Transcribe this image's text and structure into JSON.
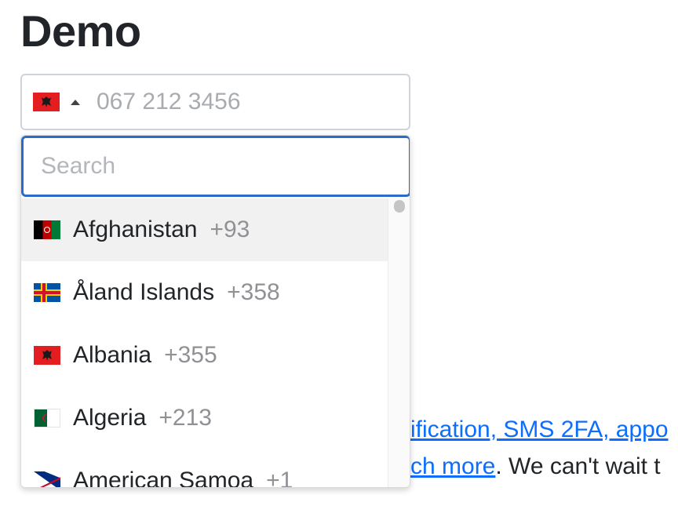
{
  "page": {
    "title": "Demo",
    "body_line1_link": "ification, SMS 2FA, appo",
    "body_line2_link": "ch more",
    "body_line2_text": ". We can't wait t"
  },
  "phone_input": {
    "selected_country": "Albania",
    "selected_flag": "albania-flag-icon",
    "caret_icon": "caret-up-icon",
    "placeholder": "067 212 3456",
    "value": ""
  },
  "dropdown": {
    "search_placeholder": "Search",
    "search_value": "",
    "countries": [
      {
        "name": "Afghanistan",
        "code": "+93",
        "flag": "afghanistan-flag-icon"
      },
      {
        "name": "Åland Islands",
        "code": "+358",
        "flag": "aland-flag-icon"
      },
      {
        "name": "Albania",
        "code": "+355",
        "flag": "albania-flag-icon"
      },
      {
        "name": "Algeria",
        "code": "+213",
        "flag": "algeria-flag-icon"
      },
      {
        "name": "American Samoa",
        "code": "+1",
        "flag": "american-samoa-flag-icon"
      }
    ]
  },
  "colors": {
    "link": "#0d6efd",
    "focus_border": "#2a6cc8",
    "highlight_row": "#f1f1f1",
    "dial_code": "#8f9194"
  }
}
